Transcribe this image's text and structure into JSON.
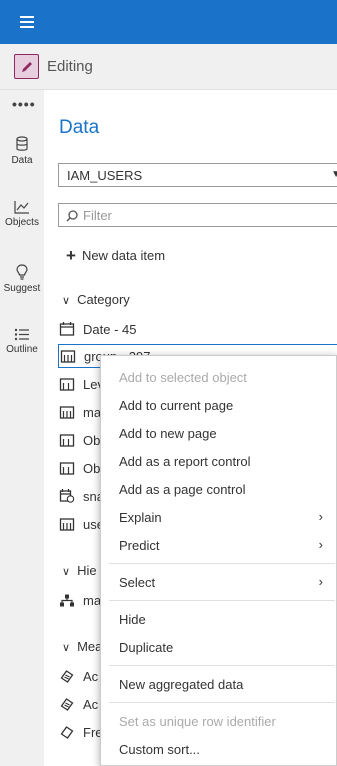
{
  "toolbar": {
    "mode_label": "Editing"
  },
  "nav": {
    "items": [
      {
        "label": "Data"
      },
      {
        "label": "Objects"
      },
      {
        "label": "Suggest"
      },
      {
        "label": "Outline"
      }
    ]
  },
  "panel": {
    "title": "Data",
    "data_source": "IAM_USERS",
    "filter_placeholder": "Filter",
    "new_item_label": "New data item",
    "category_header": "Category",
    "hierarchy_header_visible": "Hie",
    "measure_header_visible": "Mea",
    "items": [
      {
        "label": "Date - 45"
      },
      {
        "label": "group - 297"
      },
      {
        "label": "Lev"
      },
      {
        "label": "ma"
      },
      {
        "label": "Ob"
      },
      {
        "label": "Ob"
      },
      {
        "label": "sna"
      },
      {
        "label": "use"
      }
    ],
    "hierarchy_items": [
      {
        "label": "ma"
      }
    ],
    "measure_items": [
      {
        "label": "Ac"
      },
      {
        "label": "Ac"
      },
      {
        "label": "Fre"
      }
    ]
  },
  "context_menu": {
    "items": [
      {
        "label": "Add to selected object",
        "disabled": true
      },
      {
        "label": "Add to current page"
      },
      {
        "label": "Add to new page"
      },
      {
        "label": "Add as a report control"
      },
      {
        "label": "Add as a page control"
      },
      {
        "label": "Explain",
        "submenu": true
      },
      {
        "label": "Predict",
        "submenu": true
      },
      {
        "label": "Select",
        "submenu": true
      },
      {
        "label": "Hide"
      },
      {
        "label": "Duplicate"
      },
      {
        "label": "New aggregated data"
      },
      {
        "label": "Set as unique row identifier",
        "disabled": true
      },
      {
        "label": "Custom sort..."
      }
    ]
  },
  "colors": {
    "accent": "#1a73c8",
    "edit_accent": "#8e2963"
  }
}
